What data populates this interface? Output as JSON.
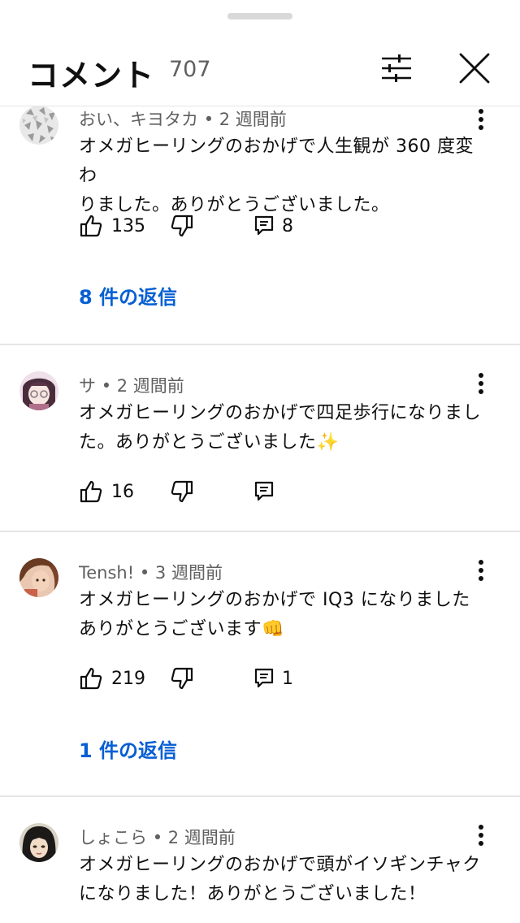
{
  "header": {
    "title": "コメント",
    "count": "707"
  },
  "comments": [
    {
      "author": "おい、キヨタカ",
      "time": "2 週間前",
      "lines": [
        "オメガヒーリングのおかげで人生観が 360 度変わ",
        "りました。ありがとうございました。"
      ],
      "likes": "135",
      "replies": "8",
      "replies_link": "8 件の返信"
    },
    {
      "author": "サ",
      "time": "2 週間前",
      "lines": [
        "オメガヒーリングのおかげで四足歩行になりまし",
        "た。ありがとうございました✨"
      ],
      "likes": "16",
      "replies": "",
      "replies_link": ""
    },
    {
      "author": "Tensh!",
      "time": "3 週間前",
      "lines": [
        "オメガヒーリングのおかげで IQ3 になりました",
        "ありがとうございます👊"
      ],
      "likes": "219",
      "replies": "1",
      "replies_link": "1 件の返信"
    },
    {
      "author": "しょこら",
      "time": "2 週間前",
      "lines": [
        "オメガヒーリングのおかげで頭がイソギンチャク",
        "になりました！ありがとうございました！"
      ],
      "likes": "",
      "replies": "",
      "replies_link": ""
    }
  ],
  "colors": {
    "link": "#065fd4",
    "meta": "#606060",
    "divider": "#e5e5e5"
  }
}
